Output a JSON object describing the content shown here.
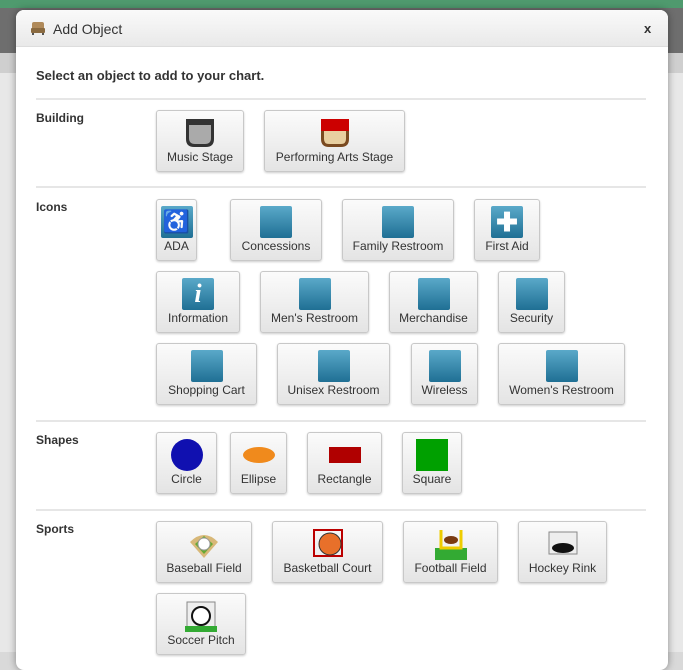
{
  "dialog": {
    "title": "Add Object",
    "close_label": "x",
    "intro": "Select an object to add to your chart."
  },
  "sections": [
    {
      "label": "Building",
      "items": [
        {
          "label": "Music Stage",
          "icon": "music-stage-icon"
        },
        {
          "label": "Performing Arts Stage",
          "icon": "performing-arts-stage-icon"
        }
      ]
    },
    {
      "label": "Icons",
      "items": [
        {
          "label": "ADA",
          "icon": "wheelchair-icon"
        },
        {
          "label": "Concessions",
          "icon": "concessions-icon"
        },
        {
          "label": "Family Restroom",
          "icon": "family-restroom-icon"
        },
        {
          "label": "First Aid",
          "icon": "first-aid-icon"
        },
        {
          "label": "Information",
          "icon": "information-icon"
        },
        {
          "label": "Men's Restroom",
          "icon": "mens-restroom-icon"
        },
        {
          "label": "Merchandise",
          "icon": "shopping-bag-icon"
        },
        {
          "label": "Security",
          "icon": "badge-icon"
        },
        {
          "label": "Shopping Cart",
          "icon": "shopping-cart-icon"
        },
        {
          "label": "Unisex Restroom",
          "icon": "unisex-restroom-icon"
        },
        {
          "label": "Wireless",
          "icon": "wireless-icon"
        },
        {
          "label": "Women's Restroom",
          "icon": "womens-restroom-icon"
        }
      ]
    },
    {
      "label": "Shapes",
      "items": [
        {
          "label": "Circle",
          "color": "#1010b0"
        },
        {
          "label": "Ellipse",
          "color": "#f08a1c"
        },
        {
          "label": "Rectangle",
          "color": "#b00000"
        },
        {
          "label": "Square",
          "color": "#00a000"
        }
      ]
    },
    {
      "label": "Sports",
      "items": [
        {
          "label": "Baseball Field",
          "icon": "baseball-icon"
        },
        {
          "label": "Basketball Court",
          "icon": "basketball-icon"
        },
        {
          "label": "Football Field",
          "icon": "football-icon"
        },
        {
          "label": "Hockey Rink",
          "icon": "hockey-icon"
        },
        {
          "label": "Soccer Pitch",
          "icon": "soccer-icon"
        }
      ]
    }
  ]
}
